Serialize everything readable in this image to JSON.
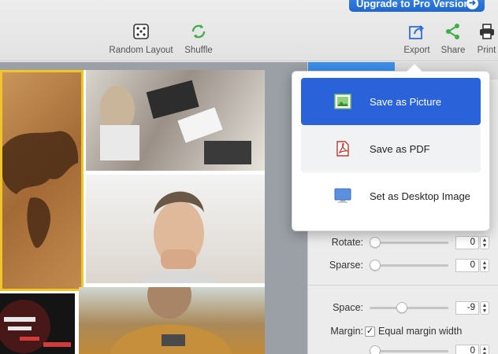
{
  "toolbar": {
    "upgrade_label": "Upgrade to Pro Version",
    "random_layout": "Random Layout",
    "shuffle": "Shuffle",
    "export": "Export",
    "share": "Share",
    "print": "Print"
  },
  "export_menu": {
    "items": [
      {
        "label": "Save as Picture",
        "icon": "picture-icon",
        "selected": true
      },
      {
        "label": "Save as PDF",
        "icon": "pdf-icon",
        "selected": false
      },
      {
        "label": "Set as Desktop Image",
        "icon": "monitor-icon",
        "selected": false
      }
    ]
  },
  "settings": {
    "rotate": {
      "label": "Rotate:",
      "value": "0",
      "level": 0
    },
    "sparse": {
      "label": "Sparse:",
      "value": "0",
      "level": 0
    },
    "space": {
      "label": "Space:",
      "value": "-9",
      "level": 0.4
    },
    "margin": {
      "label": "Margin:",
      "checkbox_label": "Equal margin width",
      "checked": true,
      "value": "0",
      "level": 0
    }
  },
  "colors": {
    "accent": "#2a63d9",
    "upgrade": "#1f67cf",
    "highlight_border": "#f2c526"
  }
}
